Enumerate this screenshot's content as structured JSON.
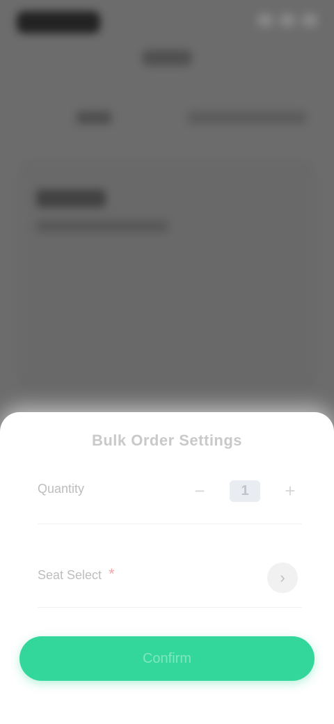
{
  "sheet": {
    "title": "Bulk Order Settings",
    "quantity_label": "Quantity",
    "quantity_value": "1",
    "minus": "−",
    "plus": "+",
    "seat_label": "Seat Select",
    "required_mark": "*",
    "seat_icon": "chevron-right-icon",
    "seat_icon_glyph": "›",
    "confirm_label": "Confirm"
  },
  "colors": {
    "accent": "#34d79b",
    "overlay": "#6c6c6c",
    "required": "#f2a6ab"
  }
}
